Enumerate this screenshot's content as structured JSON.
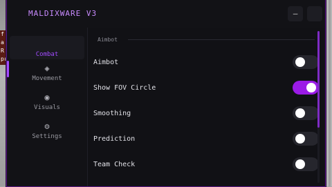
{
  "background": {
    "sign_text": [
      "f",
      "a",
      "R",
      "pro"
    ]
  },
  "window": {
    "title": "MALDIXWARE  V3",
    "minimize_label": "—",
    "close_label": "",
    "accent_color": "#a24bff"
  },
  "sidebar": {
    "items": [
      {
        "label": "Combat",
        "icon": "crosshair-icon",
        "glyph": "",
        "active": true
      },
      {
        "label": "Movement",
        "icon": "movement-icon",
        "glyph": "◈",
        "active": false
      },
      {
        "label": "Visuals",
        "icon": "eye-icon",
        "glyph": "◉",
        "active": false
      },
      {
        "label": "Settings",
        "icon": "gear-icon",
        "glyph": "⚙",
        "active": false
      }
    ]
  },
  "content": {
    "section_title": "Aimbot",
    "settings": [
      {
        "label": "Aimbot",
        "enabled": false
      },
      {
        "label": "Show FOV Circle",
        "enabled": true
      },
      {
        "label": "Smoothing",
        "enabled": false
      },
      {
        "label": "Prediction",
        "enabled": false
      },
      {
        "label": "Team Check",
        "enabled": false
      }
    ]
  }
}
